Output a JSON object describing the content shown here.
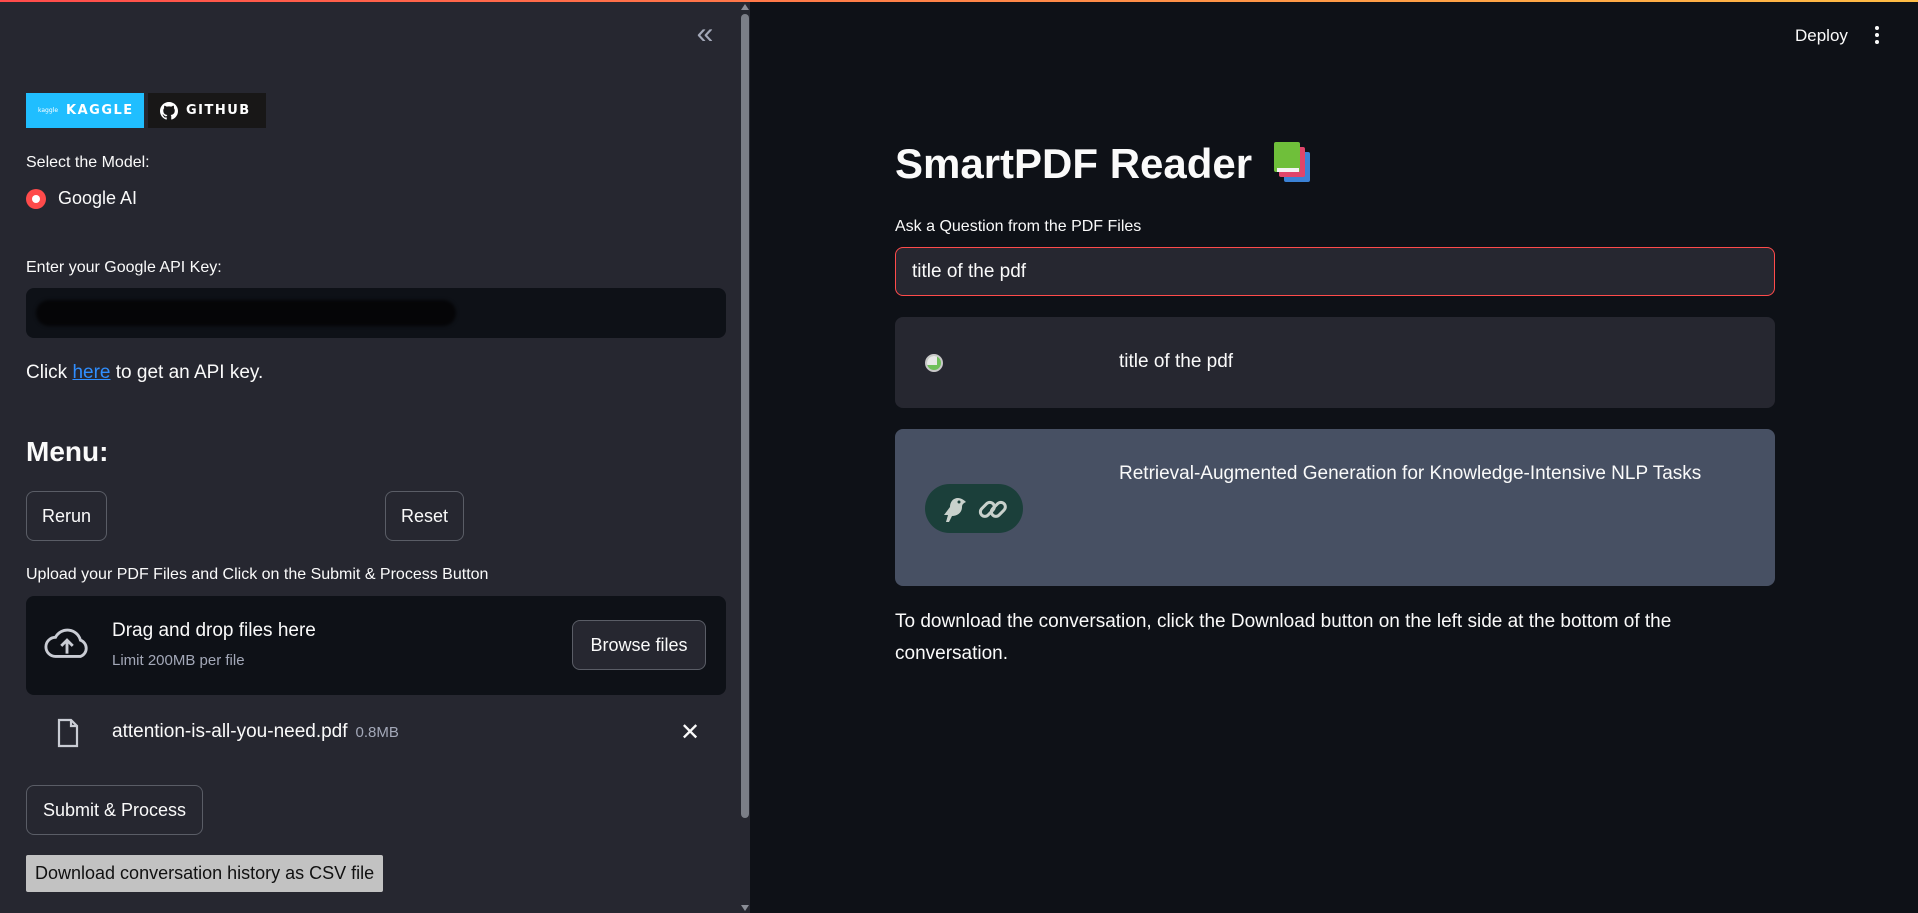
{
  "sidebar": {
    "collapse_glyph": "«",
    "badges": {
      "kaggle_mini": "kaggle",
      "kaggle": "KAGGLE",
      "github": "GITHUB"
    },
    "model_label": "Select the Model:",
    "model_option": "Google AI",
    "api_key_label": "Enter your Google API Key:",
    "click_prefix": "Click",
    "click_link": "here",
    "click_suffix": "to get an API key.",
    "menu_heading": "Menu:",
    "rerun_label": "Rerun",
    "reset_label": "Reset",
    "upload_label": "Upload your PDF Files and Click on the Submit & Process Button",
    "uploader": {
      "title": "Drag and drop files here",
      "subtitle": "Limit 200MB per file",
      "browse_label": "Browse files"
    },
    "file": {
      "name": "attention-is-all-you-need.pdf",
      "size": "0.8MB",
      "remove_glyph": "✕"
    },
    "submit_label": "Submit & Process",
    "download_label": "Download conversation history as CSV file"
  },
  "header": {
    "deploy_label": "Deploy"
  },
  "main": {
    "title": "SmartPDF Reader",
    "question_label": "Ask a Question from the PDF Files",
    "question_value": "title of the pdf",
    "messages": [
      {
        "role": "user",
        "text": "title of the pdf"
      },
      {
        "role": "assistant",
        "text": "Retrieval-Augmented Generation for Knowledge-Intensive NLP Tasks"
      }
    ],
    "footer_note": "To download the conversation, click the Download button on the left side at the bottom of the conversation."
  },
  "colors": {
    "accent": "#ff4b4b",
    "sidebar_bg": "#262730",
    "main_bg": "#0e1117",
    "link": "#2f8eff",
    "kaggle": "#20beff",
    "github": "#181717",
    "assistant_bg": "#475063"
  },
  "icons": [
    "collapse-chevrons-icon",
    "kaggle-logo-icon",
    "github-logo-icon",
    "radio-selected-icon",
    "cloud-upload-icon",
    "file-icon",
    "close-icon",
    "kebab-menu-icon",
    "books-icon",
    "user-avatar-icon",
    "parrot-link-icon"
  ]
}
